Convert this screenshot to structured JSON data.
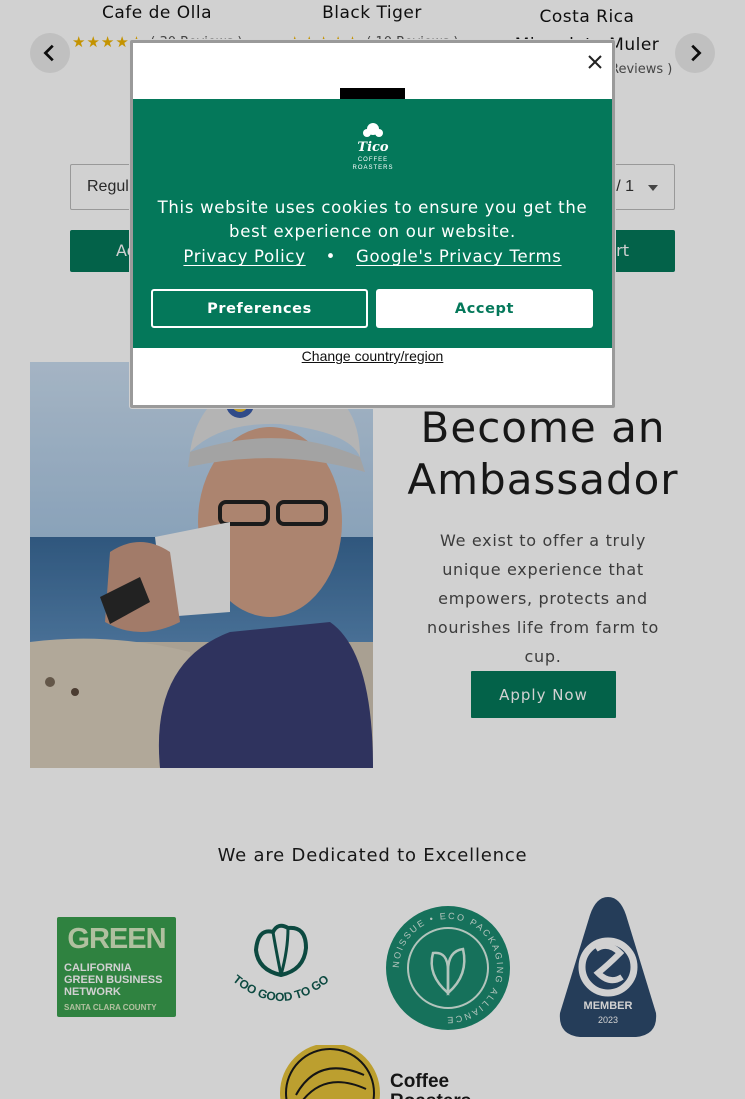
{
  "carousel": {
    "products": [
      {
        "title": "Cafe de Olla",
        "reviews": "( 30 Reviews )"
      },
      {
        "title": "Black Tiger",
        "reviews": "( 10 Reviews )"
      },
      {
        "title": "Costa Rica Microdota Muler Honey",
        "reviews": "Reviews )"
      }
    ],
    "stars": "★★★★★",
    "prev_icon": "chevron-left-icon",
    "next_icon": "chevron-right-icon"
  },
  "variant": {
    "value": "Regula",
    "qty": "/ 1"
  },
  "cart": {
    "left_label": "Ad",
    "right_label": "art"
  },
  "ambassador": {
    "title": "Become an Ambassador",
    "text": "We exist to offer a truly unique experience that empowers, protects and nourishes life from farm to cup.",
    "button": "Apply Now"
  },
  "excellence_title": "We are Dedicated to Excellence",
  "badges": {
    "green": {
      "big": "GREEN",
      "lines": [
        "CALIFORNIA",
        "GREEN BUSINESS",
        "NETWORK"
      ],
      "county": "SANTA CLARA COUNTY"
    },
    "tgtg": "TOO GOOD TO GO",
    "noissue": "NOISSUE • ECO PACKAGING ALLIANCE",
    "sca": {
      "member": "MEMBER",
      "year": "2023"
    },
    "cr": {
      "line1": "Coffee",
      "line2": "Roasters"
    }
  },
  "cookie": {
    "logo_line1": "Tico",
    "logo_line2": "COFFEE",
    "logo_line3": "ROASTERS",
    "message": "This website uses cookies to ensure you get the best experience on our website.",
    "privacy_link": "Privacy Policy",
    "separator": "•",
    "terms_link": "Google's Privacy Terms",
    "preferences": "Preferences",
    "accept": "Accept",
    "change_country": "Change country/region",
    "close_icon": "close-icon"
  },
  "colors": {
    "brand_green": "#04785a",
    "star": "#f0b400",
    "badge_green": "#3a9f4f",
    "badge_teal": "#1c8a6f",
    "sca_navy": "#2e4b6d"
  }
}
